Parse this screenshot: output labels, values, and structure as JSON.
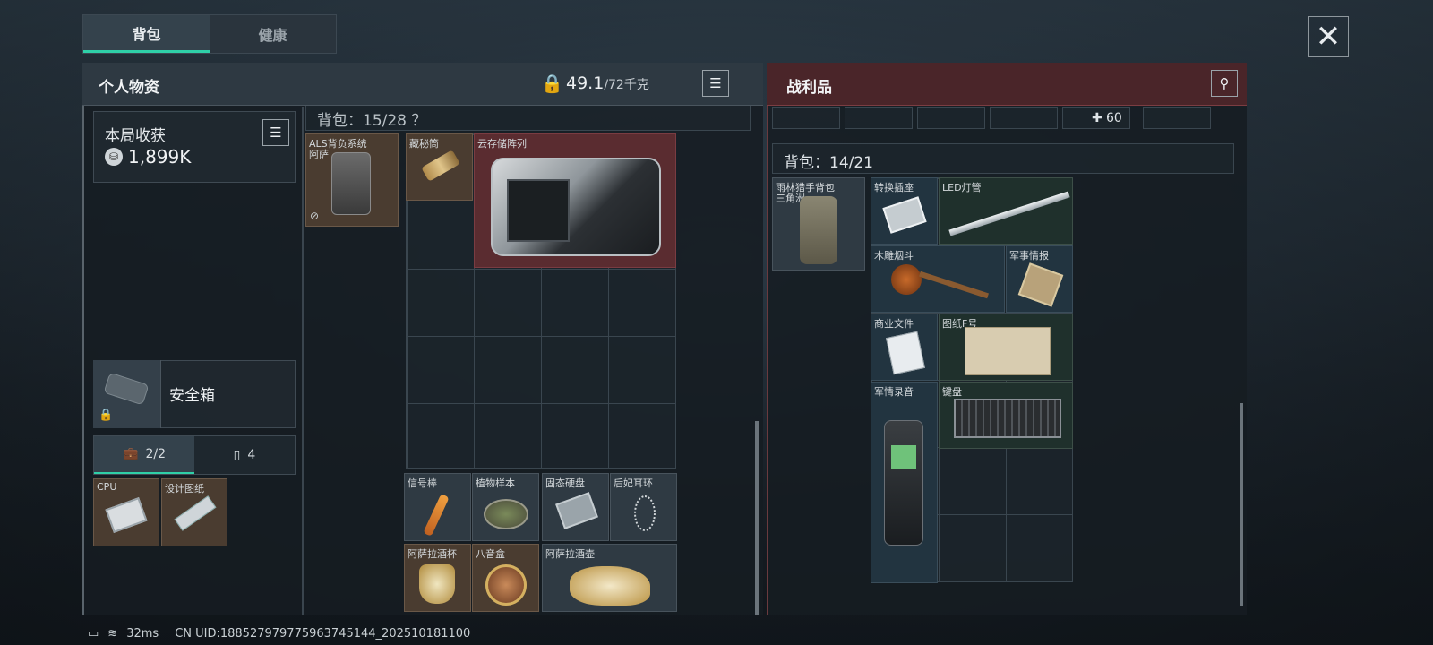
{
  "tabs": [
    {
      "label": "背包",
      "active": true
    },
    {
      "label": "健康",
      "active": false
    }
  ],
  "close_icon": "close-icon",
  "left_panel": {
    "title": "个人物资",
    "weight_current": "49.1",
    "weight_max": "/72千克",
    "harvest": {
      "label": "本局收获",
      "value": "1,899K"
    },
    "backpack_label": "背包：15/28 ？",
    "safe_box": {
      "label": "安全箱"
    },
    "sub_tabs": [
      {
        "label": "2/2",
        "icon": "briefcase-icon",
        "active": true
      },
      {
        "label": "4",
        "icon": "battery-icon",
        "active": false
      }
    ],
    "safe_items": [
      {
        "name": "CPU"
      },
      {
        "name": "设计图纸"
      }
    ],
    "backpack_item": {
      "name": "ALS背负系统",
      "sub": "阿萨"
    },
    "items": [
      {
        "name": "藏秘筒"
      },
      {
        "name": "云存储阵列"
      },
      {
        "name": "信号棒"
      },
      {
        "name": "植物样本"
      },
      {
        "name": "固态硬盘"
      },
      {
        "name": "后妃耳环"
      },
      {
        "name": "阿萨拉酒杯"
      },
      {
        "name": "八音盒"
      },
      {
        "name": "阿萨拉酒壶"
      }
    ]
  },
  "right_panel": {
    "title": "战利品",
    "top_count": "60",
    "backpack_label": "背包：14/21",
    "backpack_item": {
      "name": "雨林猎手背包",
      "sub": "三角洲"
    },
    "items": [
      {
        "name": "转换插座"
      },
      {
        "name": "LED灯管"
      },
      {
        "name": "木雕烟斗"
      },
      {
        "name": "军事情报"
      },
      {
        "name": "商业文件"
      },
      {
        "name": "图纸F号"
      },
      {
        "name": "军情录音"
      },
      {
        "name": "键盘"
      }
    ]
  },
  "status_bar": {
    "ping": "32ms",
    "uid": "CN UID:188527979775963745144_202510181100"
  },
  "colors": {
    "accent": "#2fd0a8",
    "loot_header": "#4a2529",
    "rare_red": "#5a2c30",
    "brown": "#4a3c30"
  }
}
